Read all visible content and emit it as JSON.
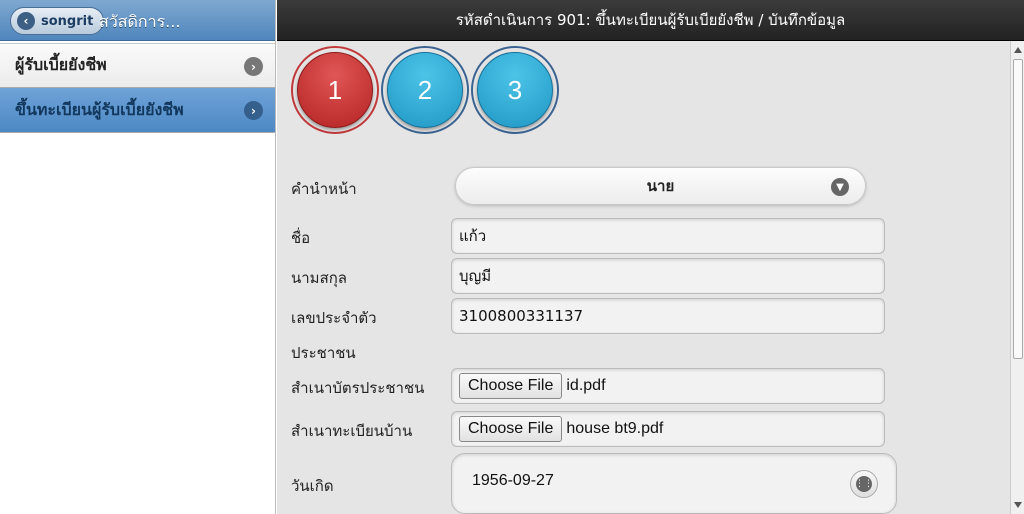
{
  "left_panel": {
    "back_label": "songrit",
    "greeting": "สวัสดิการ...",
    "items": [
      {
        "label": "ผู้รับเบี้ยยังชีพ"
      },
      {
        "label": "ขึ้นทะเบียนผู้รับเบี้ยยังชีพ"
      }
    ]
  },
  "header": {
    "title": "รหัสดำเนินการ 901: ขึ้นทะเบียนผู้รับเบียยังชีพ / บันทึกข้อมูล"
  },
  "steps": [
    "1",
    "2",
    "3"
  ],
  "form": {
    "prefix_label": "คำนำหน้า",
    "prefix_value": "นาย",
    "first_name_label": "ชื่อ",
    "first_name_value": "แก้ว",
    "last_name_label": "นามสกุล",
    "last_name_value": "บุญมี",
    "id_label_line1": "เลขประจำตัว",
    "id_label_line2": "ประชาชน",
    "id_value": "3100800331137",
    "id_copy_label": "สำเนาบัตรประชาชน",
    "id_copy_button": "Choose File",
    "id_copy_file": "id.pdf",
    "house_copy_label": "สำเนาทะเบียนบ้าน",
    "house_copy_button": "Choose File",
    "house_copy_file": "house bt9.pdf",
    "birth_label": "วันเกิด",
    "birth_value": "1956-09-27"
  },
  "colors": {
    "step_active": "#c43a3a",
    "step_inactive": "#2aa8d4",
    "header_bg": "#2a2a2a",
    "nav_active": "#5a93cd"
  }
}
